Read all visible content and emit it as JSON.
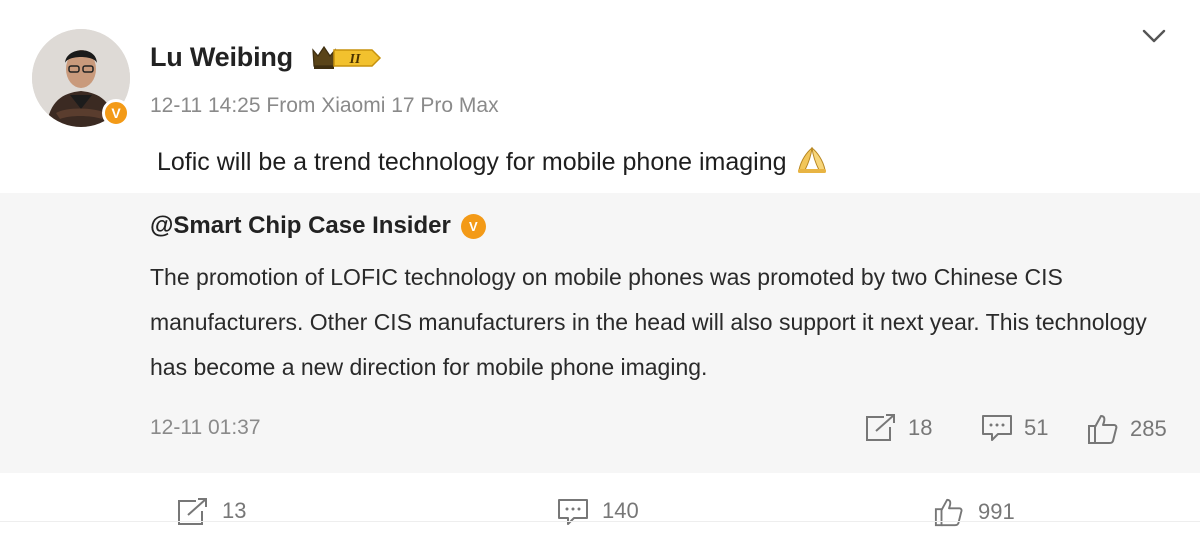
{
  "post": {
    "author": "Lu Weibing",
    "level_badge": "II",
    "meta": "12-11 14:25 From Xiaomi 17 Pro Max",
    "text": "Lofic will be a trend technology for mobile phone imaging",
    "verify_mark": "V"
  },
  "quote": {
    "author": "@Smart Chip Case Insider",
    "body": " The promotion of LOFIC technology on mobile phones was promoted by two Chinese CIS manufacturers. Other CIS manufacturers in the head will also support it next year. This technology has become a new direction for mobile phone imaging.",
    "time": "12-11 01:37",
    "reposts": "18",
    "comments": "51",
    "likes": "285"
  },
  "footer": {
    "reposts": "13",
    "comments": "140",
    "likes": "991"
  },
  "icons": {
    "repost": "repost-icon",
    "comment": "comment-icon",
    "like": "like-icon",
    "chevron": "chevron-down-icon",
    "clap": "pray-hands-icon"
  },
  "colors": {
    "verify_orange": "#f39a17",
    "quote_bg": "#f6f6f6",
    "meta_gray": "#8a8a8a"
  }
}
